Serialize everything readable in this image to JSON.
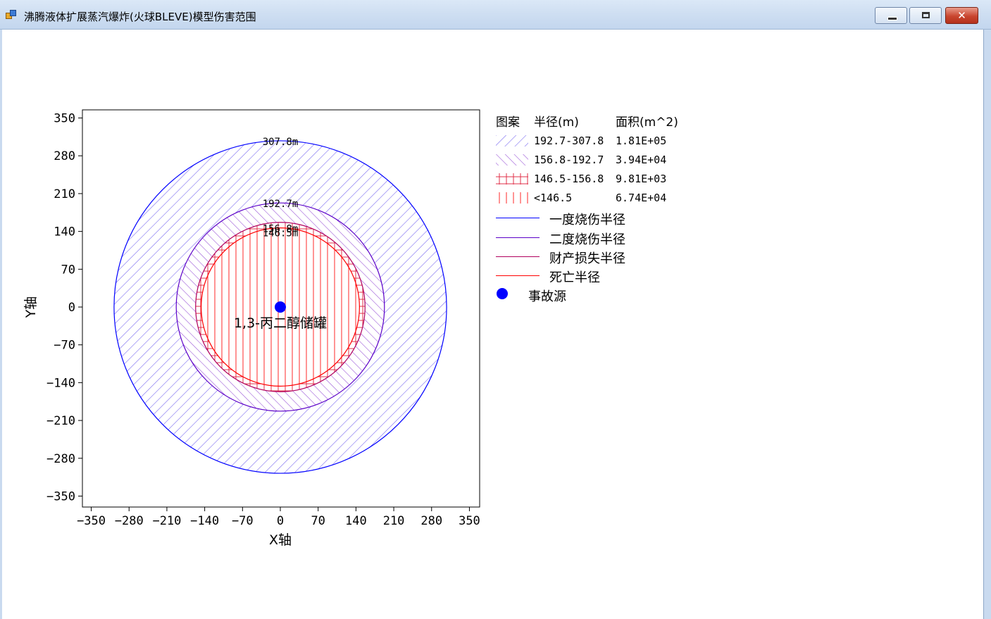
{
  "window": {
    "title": "沸腾液体扩展蒸汽爆炸(火球BLEVE)模型伤害范围",
    "icon": "app-window-icon",
    "controls": {
      "minimize": "minimize-icon",
      "maximize": "maximize-icon",
      "close": "close-icon"
    }
  },
  "chart_data": {
    "type": "concentric-circles",
    "xlabel": "X轴",
    "ylabel": "Y轴",
    "xlim": [
      -360,
      365
    ],
    "ylim": [
      -370,
      365
    ],
    "xticks": [
      -350,
      -280,
      -210,
      -140,
      -70,
      0,
      70,
      140,
      210,
      280,
      350
    ],
    "yticks": [
      350,
      280,
      210,
      140,
      70,
      0,
      -70,
      -140,
      -210,
      -280,
      -350
    ],
    "center": [
      0,
      0
    ],
    "source_label": "1,3-丙二醇储罐",
    "circles": [
      {
        "name": "一度烧伤半径",
        "radius": 307.8,
        "label": "307.8m",
        "color": "#0000ff"
      },
      {
        "name": "二度烧伤半径",
        "radius": 192.7,
        "label": "192.7m",
        "color": "#5b00c8"
      },
      {
        "name": "财产损失半径",
        "radius": 156.8,
        "label": "156.8m",
        "color": "#b0005e"
      },
      {
        "name": "死亡半径",
        "radius": 146.5,
        "label": "146.5m",
        "color": "#ff0000"
      }
    ],
    "zones": [
      {
        "pattern": "hatch-forward",
        "color": "#7b6cf0",
        "range": "192.7-307.8",
        "area": "1.81E+05",
        "inner": 192.7,
        "outer": 307.8
      },
      {
        "pattern": "hatch-back",
        "color": "#9c5ad8",
        "range": "156.8-192.7",
        "area": "3.94E+04",
        "inner": 156.8,
        "outer": 192.7
      },
      {
        "pattern": "cross",
        "color": "#e0304a",
        "range": "146.5-156.8",
        "area": "9.81E+03",
        "inner": 146.5,
        "outer": 156.8
      },
      {
        "pattern": "vertical",
        "color": "#ff2a2a",
        "range": "<146.5",
        "area": "6.74E+04",
        "inner": 0,
        "outer": 146.5
      }
    ]
  },
  "legend": {
    "headers": {
      "pattern": "图案",
      "radius": "半径(m)",
      "area": "面积(m^2)"
    },
    "lines": [
      {
        "label": "一度烧伤半径",
        "color": "#0000ff"
      },
      {
        "label": "二度烧伤半径",
        "color": "#5b00c8"
      },
      {
        "label": "财产损失半径",
        "color": "#b0005e"
      },
      {
        "label": "死亡半径",
        "color": "#ff0000"
      }
    ],
    "source": {
      "label": "事故源",
      "color": "#0000ff"
    }
  }
}
